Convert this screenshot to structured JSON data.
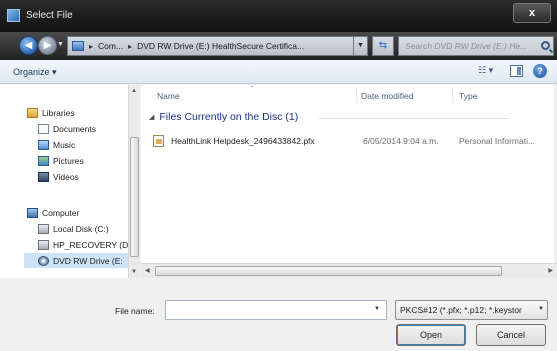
{
  "window": {
    "title": "Select File",
    "close_label": "x"
  },
  "address": {
    "breadcrumb": [
      "Com...",
      "DVD RW Drive (E:) HealthSecure Certifica..."
    ],
    "search_placeholder": "Search DVD RW Drive (E:) He..."
  },
  "toolbar": {
    "organize_label": "Organize ▾",
    "help_label": "?"
  },
  "nav": {
    "libraries_label": "Libraries",
    "library_items": [
      "Documents",
      "Music",
      "Pictures",
      "Videos"
    ],
    "computer_label": "Computer",
    "computer_items": [
      "Local Disk (C:)",
      "HP_RECOVERY (D",
      "DVD RW Drive (E:"
    ],
    "selected": "DVD RW Drive (E:"
  },
  "filelist": {
    "columns": [
      "Name",
      "Date modified",
      "Type"
    ],
    "group_label": "Files Currently on the Disc (1)",
    "files": [
      {
        "name": "HealthLink Helpdesk_2496433842.pfx",
        "date": "6/05/2014 9:04 a.m.",
        "type": "Personal Informati..."
      }
    ]
  },
  "bottom": {
    "filename_label": "File name:",
    "filename_value": "",
    "filetype_value": "PKCS#12 (*.pfx; *.p12; *.keystor",
    "open_label": "Open",
    "cancel_label": "Cancel"
  }
}
